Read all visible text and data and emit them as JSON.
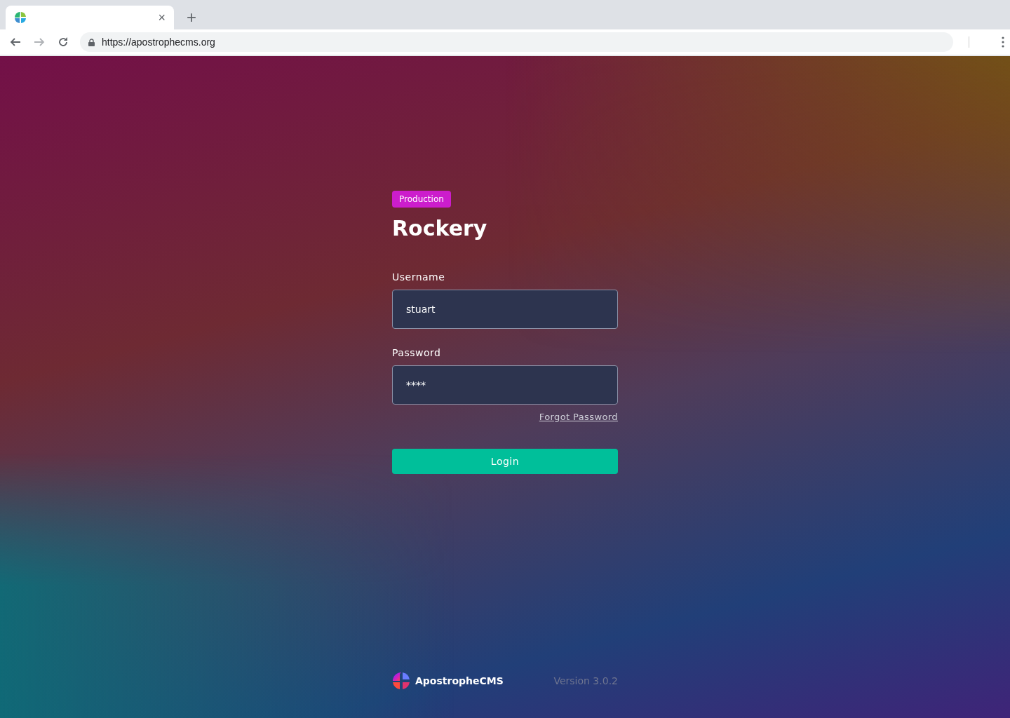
{
  "browser": {
    "url": "https://apostrophecms.org",
    "tab_close": "×",
    "new_tab": "+"
  },
  "login": {
    "environment_badge": "Production",
    "site_title": "Rockery",
    "fields": [
      {
        "label": "Username",
        "value": "stuart"
      },
      {
        "label": "Password",
        "value": "****"
      }
    ],
    "forgot_link": "Forgot Password",
    "submit": "Login"
  },
  "footer": {
    "brand": "ApostropheCMS",
    "version": "Version 3.0.2"
  }
}
